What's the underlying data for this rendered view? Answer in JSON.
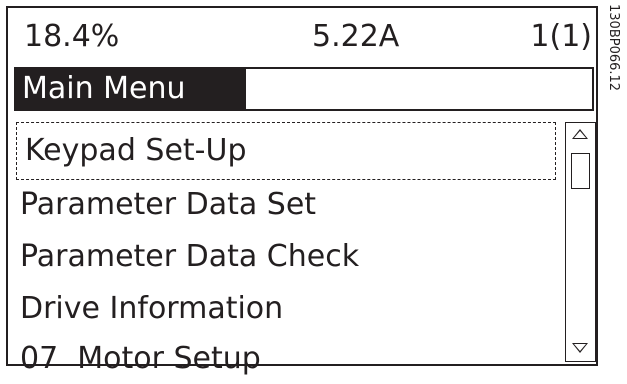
{
  "status": {
    "speed_percent": "18.4%",
    "current": "5.22A",
    "setup": "1(1)"
  },
  "menu": {
    "title": "Main Menu"
  },
  "items": [
    {
      "label": "Keypad Set-Up",
      "selected": true
    },
    {
      "label": "Parameter Data Set",
      "selected": false
    },
    {
      "label": "Parameter Data Check",
      "selected": false
    },
    {
      "label": "Drive Information",
      "selected": false
    },
    {
      "label": "07  Motor Setup",
      "selected": false
    }
  ],
  "figure_code": "130BP066.12",
  "icons": {
    "scroll_up": "triangle-up-icon",
    "scroll_down": "triangle-down-icon"
  }
}
